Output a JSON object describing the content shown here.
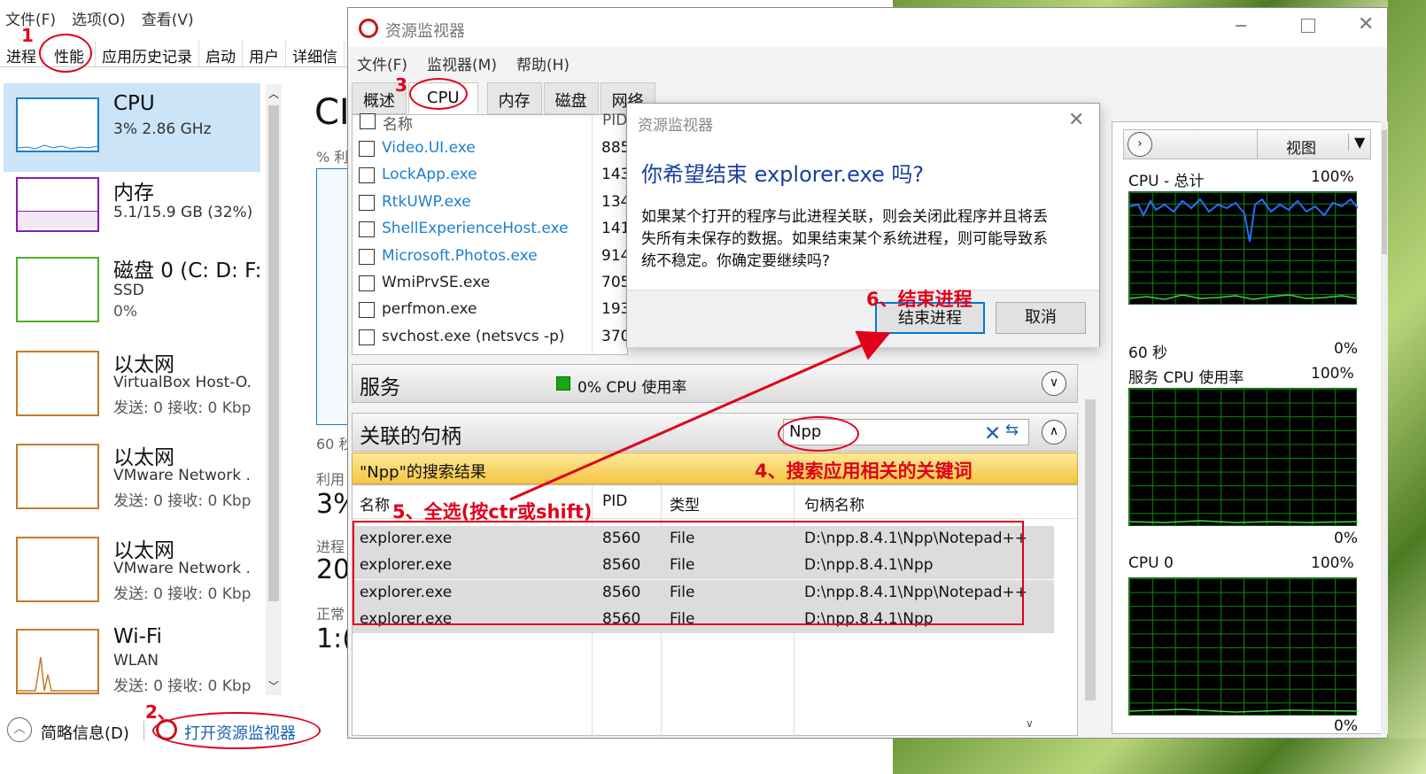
{
  "task_manager": {
    "menu": [
      "文件(F)",
      "选项(O)",
      "查看(V)"
    ],
    "tabs": [
      "进程",
      "性能",
      "应用历史记录",
      "启动",
      "用户",
      "详细信"
    ],
    "items": [
      {
        "title": "CPU",
        "sub": "3% 2.86 GHz",
        "detail": "",
        "color": "#1a7fd0"
      },
      {
        "title": "内存",
        "sub": "5.1/15.9 GB (32%)",
        "detail": "",
        "color": "#8b1bb0"
      },
      {
        "title": "磁盘 0 (C: D: F:",
        "sub": "SSD",
        "detail": "0%",
        "color": "#4caf28"
      },
      {
        "title": "以太网",
        "sub": "VirtualBox Host-O.",
        "detail": "发送: 0 接收: 0 Kbp",
        "color": "#c77a2a"
      },
      {
        "title": "以太网",
        "sub": "VMware Network .",
        "detail": "发送: 0 接收: 0 Kbp",
        "color": "#c77a2a"
      },
      {
        "title": "以太网",
        "sub": "VMware Network .",
        "detail": "发送: 0 接收: 0 Kbp",
        "color": "#c77a2a"
      },
      {
        "title": "Wi-Fi",
        "sub": "WLAN",
        "detail": "发送: 0 接收: 0 Kbp",
        "color": "#c77a2a"
      }
    ],
    "right_labels": [
      "CI",
      "% 利",
      "60 秒",
      "利用",
      "3%",
      "进程",
      "20",
      "正常",
      "1:("
    ],
    "fewer_details": "简略信息(D)",
    "open_resmon": "打开资源监视器"
  },
  "resource_monitor": {
    "title": "资源监视器",
    "menu": [
      "文件(F)",
      "监视器(M)",
      "帮助(H)"
    ],
    "tabs": [
      "概述",
      "CPU",
      "内存",
      "磁盘",
      "网络"
    ],
    "process_header": {
      "name": "名称",
      "pid": "PID"
    },
    "processes": [
      {
        "name": "Video.UI.exe",
        "pid": "885",
        "blue": true
      },
      {
        "name": "LockApp.exe",
        "pid": "143",
        "blue": true
      },
      {
        "name": "RtkUWP.exe",
        "pid": "134",
        "blue": true
      },
      {
        "name": "ShellExperienceHost.exe",
        "pid": "141",
        "blue": true
      },
      {
        "name": "Microsoft.Photos.exe",
        "pid": "914",
        "blue": true
      },
      {
        "name": "WmiPrvSE.exe",
        "pid": "705",
        "blue": false
      },
      {
        "name": "perfmon.exe",
        "pid": "193",
        "blue": false
      },
      {
        "name": "svchost.exe (netsvcs -p)",
        "pid": "370",
        "blue": false
      }
    ],
    "services": {
      "title": "服务",
      "usage": "0% CPU 使用率"
    },
    "handles": {
      "title": "关联的句柄",
      "search_value": "Npp",
      "result_label": "\"Npp\"的搜索结果",
      "columns": [
        "名称",
        "PID",
        "类型",
        "句柄名称"
      ],
      "rows": [
        [
          "explorer.exe",
          "8560",
          "File",
          "D:\\npp.8.4.1\\Npp\\Notepad++"
        ],
        [
          "explorer.exe",
          "8560",
          "File",
          "D:\\npp.8.4.1\\Npp"
        ],
        [
          "explorer.exe",
          "8560",
          "File",
          "D:\\npp.8.4.1\\Npp\\Notepad++"
        ],
        [
          "explorer.exe",
          "8560",
          "File",
          "D:\\npp.8.4.1\\Npp"
        ]
      ]
    },
    "side": {
      "view": "视图",
      "graphs": [
        {
          "title": "CPU - 总计",
          "max": "100%",
          "time": "60 秒",
          "min": "0%"
        },
        {
          "title": "服务 CPU 使用率",
          "max": "100%",
          "time": "",
          "min": "0%"
        },
        {
          "title": "CPU 0",
          "max": "100%",
          "time": "",
          "min": "0%"
        }
      ]
    }
  },
  "dialog": {
    "title": "资源监视器",
    "question": "你希望结束 explorer.exe 吗?",
    "body_lines": [
      "如果某个打开的程序与此进程关联，则会关闭此程序并且将丢",
      "失所有未保存的数据。如果结束某个系统进程，则可能导致系",
      "统不稳定。你确定要继续吗?"
    ],
    "end_button": "结束进程",
    "cancel_button": "取消"
  },
  "annotations": {
    "n1": "1",
    "n2": "2、",
    "n3": "3",
    "step4": "4、搜索应用相关的关键词",
    "step5": "5、全选(按ctr或shift)",
    "step6": "6、结束进程"
  }
}
